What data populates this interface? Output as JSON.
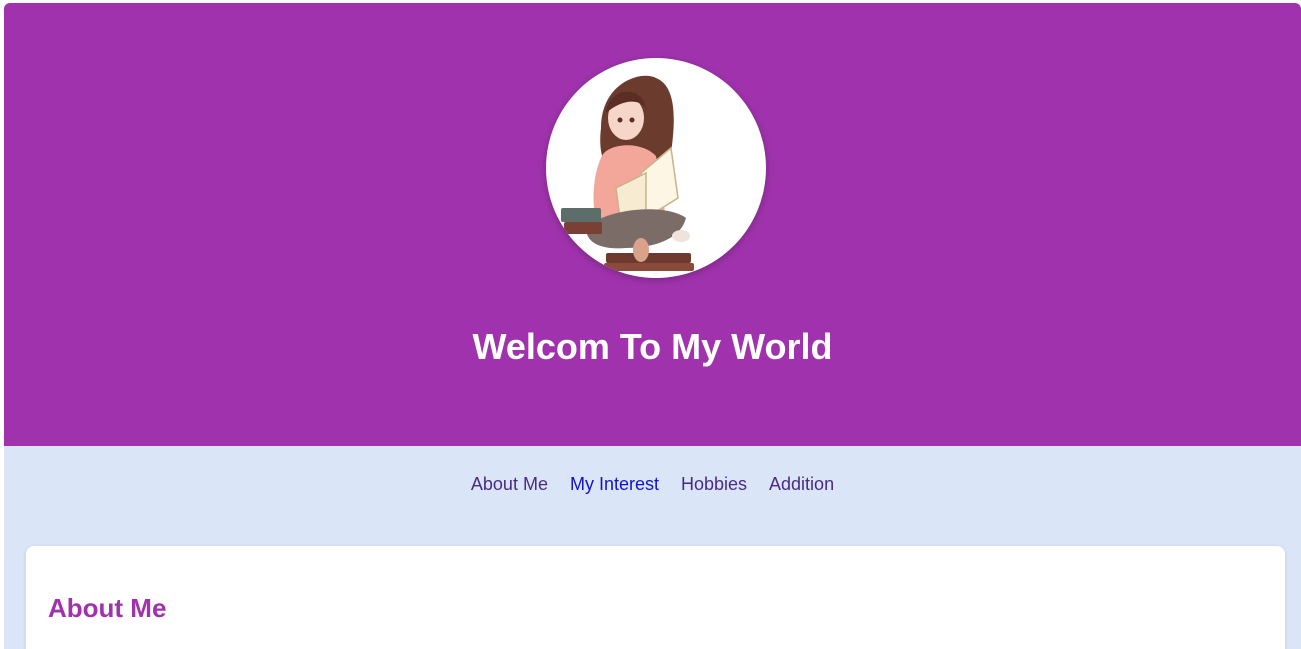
{
  "hero": {
    "title": "Welcom To My World",
    "background_color": "#a033ad",
    "avatar": {
      "icon": "girl-reading-book-illustration"
    }
  },
  "nav": {
    "items": [
      {
        "label": "About Me",
        "active": false
      },
      {
        "label": "My Interest",
        "active": true
      },
      {
        "label": "Hobbies",
        "active": false
      },
      {
        "label": "Addition",
        "active": false
      }
    ]
  },
  "about": {
    "heading": "About Me",
    "heading_color": "#a033ad"
  },
  "colors": {
    "page_background": "#dae6f8",
    "nav_link": "#4a2a86",
    "nav_link_active": "#1212c8"
  }
}
